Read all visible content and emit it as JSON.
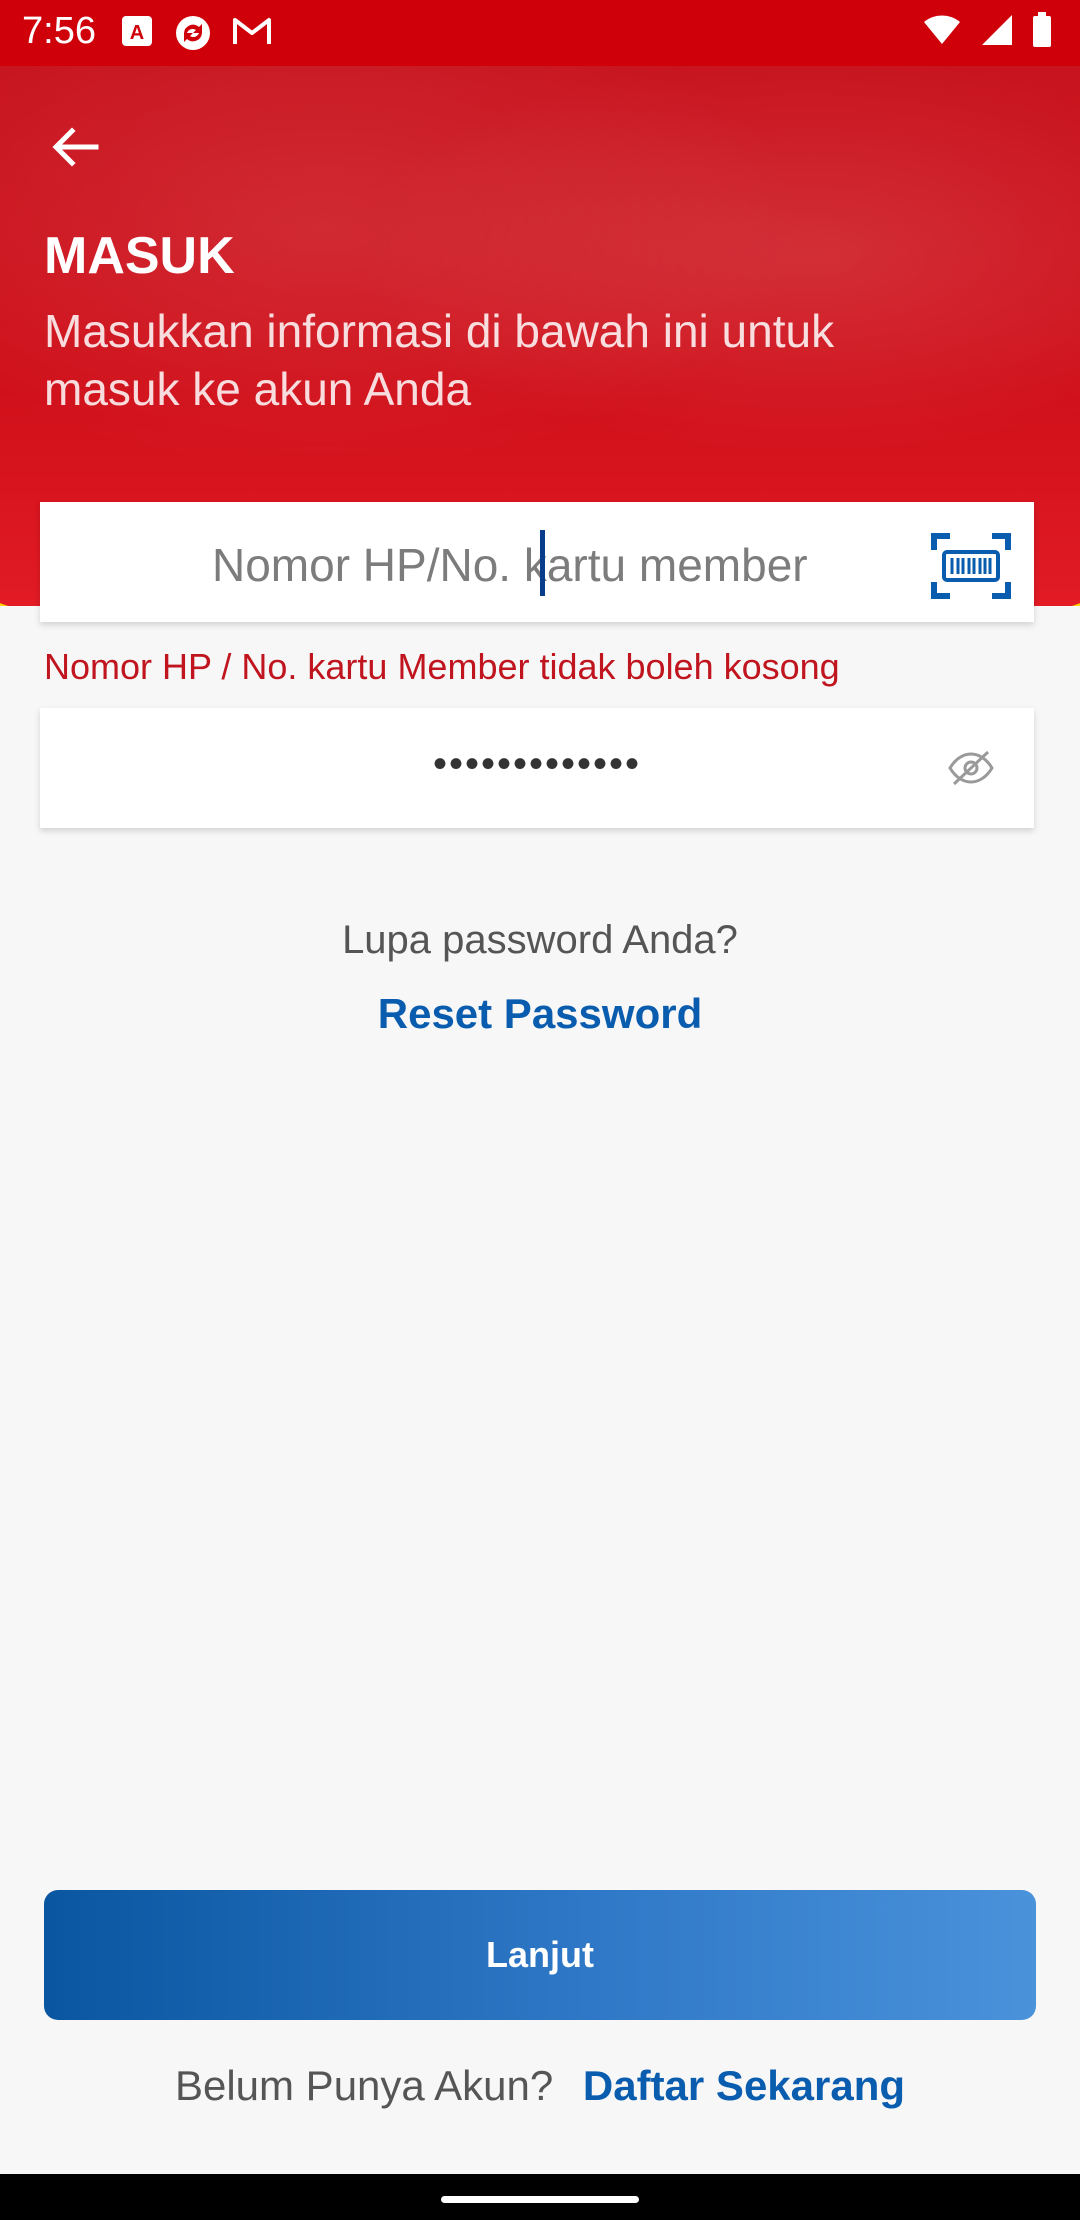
{
  "status_bar": {
    "time": "7:56",
    "left_icons": [
      "adobe-icon",
      "sync-icon",
      "gmail-icon"
    ],
    "right_icons": [
      "wifi-icon",
      "signal-icon",
      "battery-icon"
    ]
  },
  "header": {
    "title": "MASUK",
    "subtitle": "Masukkan informasi di bawah ini untuk masuk ke akun Anda",
    "brand_color": "#d0000b",
    "accent_color": "#ffd200"
  },
  "phone_field": {
    "placeholder": "Nomor HP/No. kartu member",
    "error": "Nomor HP / No. kartu Member tidak boleh kosong"
  },
  "password_field": {
    "masked_value": "•••••••••••••"
  },
  "forgot": {
    "question": "Lupa password Anda?",
    "reset_label": "Reset Password"
  },
  "continue_button": {
    "label": "Lanjut"
  },
  "register": {
    "question": "Belum Punya Akun?",
    "link": "Daftar Sekarang"
  },
  "colors": {
    "link": "#0a5cae",
    "error": "#c0141e"
  }
}
